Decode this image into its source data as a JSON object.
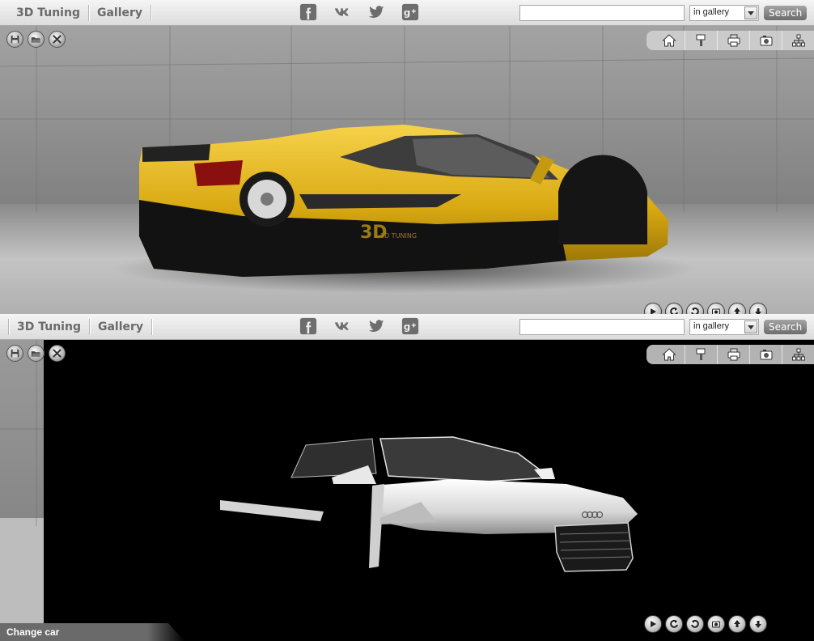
{
  "header": {
    "nav": [
      {
        "label": "3D Tuning"
      },
      {
        "label": "Gallery"
      }
    ],
    "social": [
      "facebook-icon",
      "vk-icon",
      "twitter-icon",
      "google-plus-icon"
    ],
    "search": {
      "value": "",
      "placeholder": "",
      "scope": "in gallery",
      "button": "Search"
    }
  },
  "left_tools": [
    "save-icon",
    "open-icon",
    "tools-icon"
  ],
  "right_tools": [
    "home-icon",
    "paint-brush-icon",
    "print-icon",
    "camera-icon",
    "sitemap-icon"
  ],
  "view_controls": [
    "play-icon",
    "rotate-left-icon",
    "rotate-right-icon",
    "camera-reset-icon",
    "upload-icon",
    "download-icon"
  ],
  "viewer1": {
    "car": "yellow sports car",
    "logo_text": "3D TUNING"
  },
  "viewer2": {
    "car": "white sports car",
    "change_car": "Change car"
  },
  "colors": {
    "accent": "#6a6a6a",
    "car1": "#e6bb25",
    "car2": "#e8e8e8"
  }
}
